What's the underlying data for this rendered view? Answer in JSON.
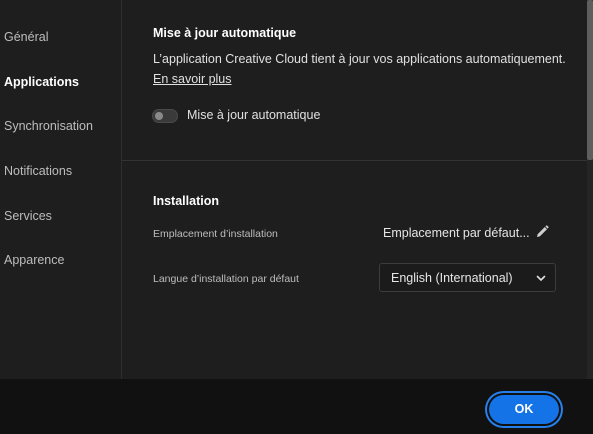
{
  "sidebar": {
    "items": [
      {
        "label": "Général"
      },
      {
        "label": "Applications",
        "active": true
      },
      {
        "label": "Synchronisation"
      },
      {
        "label": "Notifications"
      },
      {
        "label": "Services"
      },
      {
        "label": "Apparence"
      }
    ]
  },
  "auto_update": {
    "title": "Mise à jour automatique",
    "description": "L’application Creative Cloud tient à jour vos applications automatiquement.",
    "learn_more": "En savoir plus",
    "toggle_label": "Mise à jour automatique",
    "toggle_on": false
  },
  "installation": {
    "title": "Installation",
    "location_label": "Emplacement d’installation",
    "location_value": "Emplacement par défaut...",
    "language_label": "Langue d’installation par défaut",
    "language_value": "English (International)"
  },
  "footer": {
    "ok_label": "OK"
  },
  "icons": {
    "edit": "pencil-icon",
    "dropdown": "chevron-down-icon"
  },
  "colors": {
    "accent": "#1473e6",
    "background": "#1e1e1e",
    "footer_background": "#111111"
  }
}
